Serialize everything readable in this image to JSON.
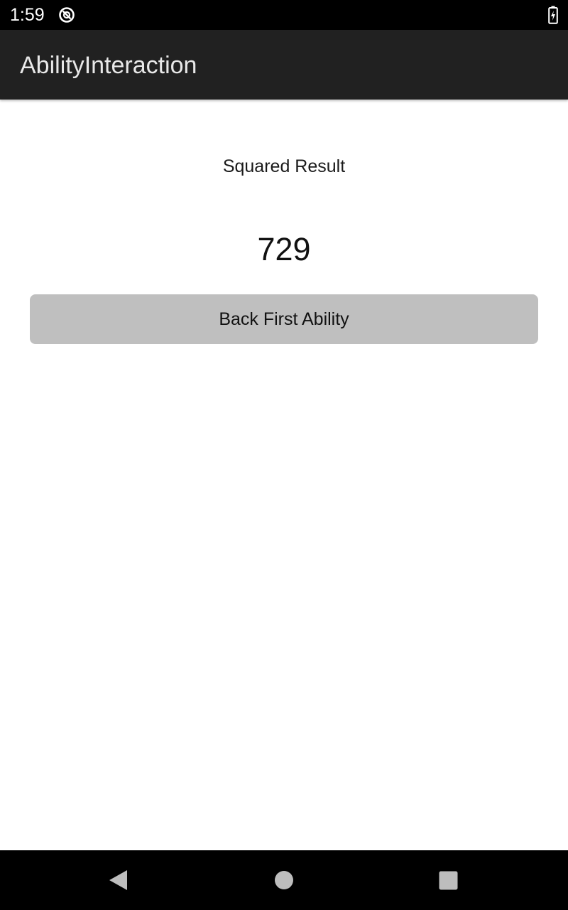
{
  "status_bar": {
    "time": "1:59",
    "icons": [
      "notification-sync-icon",
      "battery-charging-icon"
    ]
  },
  "toolbar": {
    "title": "AbilityInteraction"
  },
  "content": {
    "result_label": "Squared Result",
    "result_value": "729",
    "back_button_label": "Back First Ability"
  },
  "nav_bar": {
    "icons": [
      "nav-back-icon",
      "nav-home-icon",
      "nav-recents-icon"
    ]
  },
  "colors": {
    "status_bar_bg": "#000000",
    "toolbar_bg": "#212121",
    "toolbar_text": "#e8e8e8",
    "button_bg": "#bfbfbf",
    "nav_bar_bg": "#000000",
    "nav_icon": "#bdbdbd"
  }
}
